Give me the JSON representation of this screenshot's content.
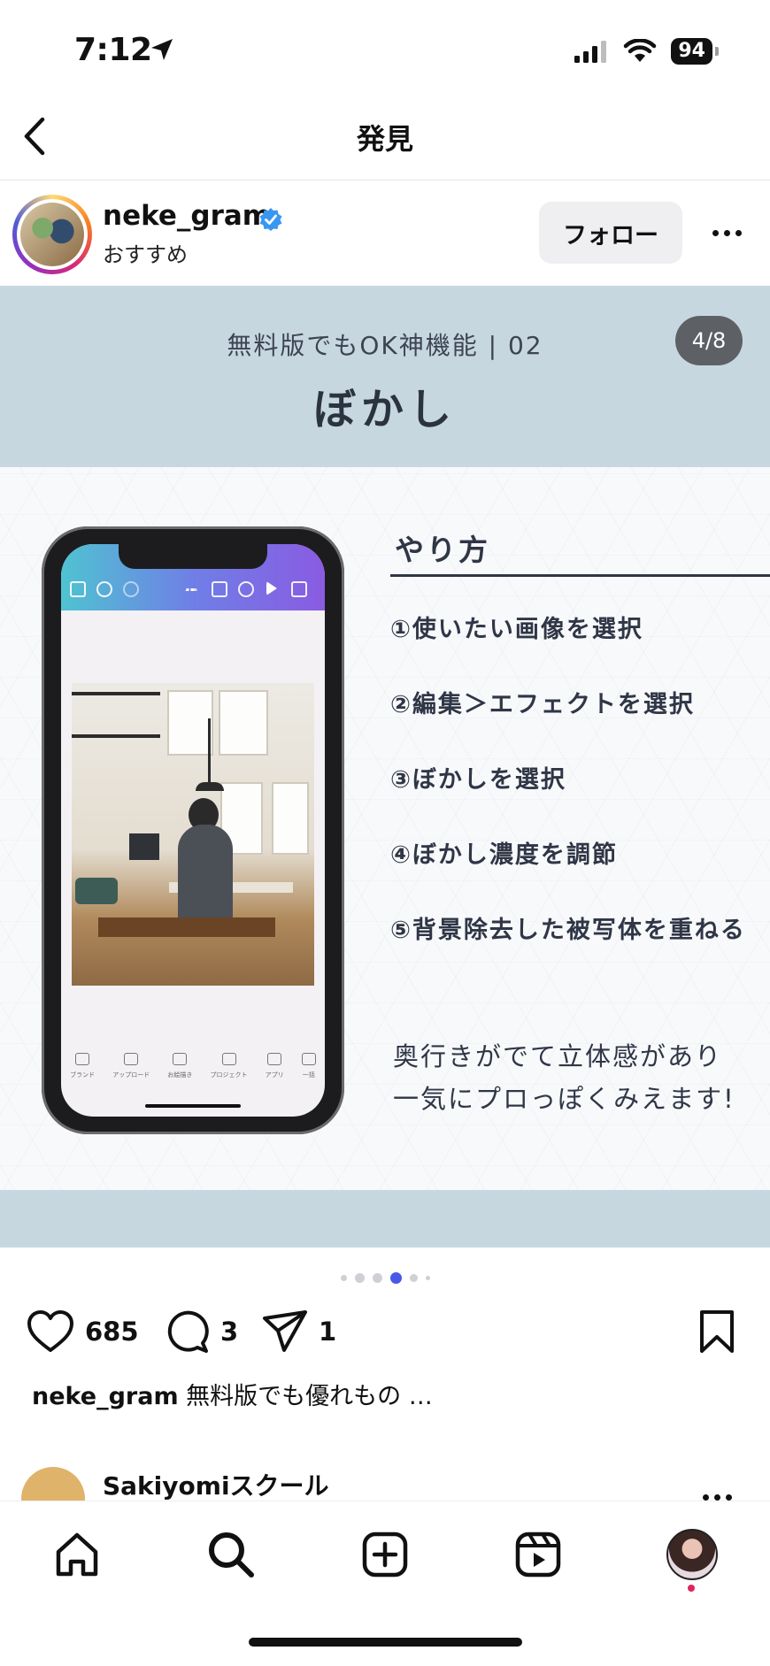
{
  "status_bar": {
    "time": "7:12",
    "battery": "94"
  },
  "header": {
    "title": "発見"
  },
  "post": {
    "username": "neke_gram",
    "subtitle": "おすすめ",
    "follow_label": "フォロー"
  },
  "slide": {
    "subtitle": "無料版でもOK神機能 | 02",
    "title": "ぼかし",
    "page_counter": "4/8",
    "method_heading": "やり方",
    "steps": [
      "①使いたい画像を選択",
      "②編集＞エフェクトを選択",
      "③ぼかしを選択",
      "④ぼかし濃度を調節",
      "⑤背景除去した被写体を重ねる"
    ],
    "note_line1": "奥行きがでて立体感があり",
    "note_line2": "一気にプロっぽくみえます!",
    "phone_tabs": [
      "ブランド",
      "アップロード",
      "お絵描き",
      "プロジェクト",
      "アプリ",
      "一括"
    ]
  },
  "carousel": {
    "total": 6,
    "active_index": 3
  },
  "actions": {
    "likes": "685",
    "comments": "3",
    "shares": "1"
  },
  "caption": {
    "username": "neke_gram",
    "text": "無料版でも優れもの …"
  },
  "next_post": {
    "username": "Sakiyomiスクール"
  },
  "colors": {
    "verified": "#3897f0",
    "carousel_active": "#4a58e8",
    "slide_band": "#c7d7e0"
  },
  "icons": {
    "status": [
      "location-arrow-icon",
      "signal-icon",
      "wifi-icon",
      "battery-icon"
    ],
    "tabbar": [
      "home-icon",
      "search-icon",
      "create-icon",
      "reels-icon",
      "profile-avatar"
    ]
  }
}
